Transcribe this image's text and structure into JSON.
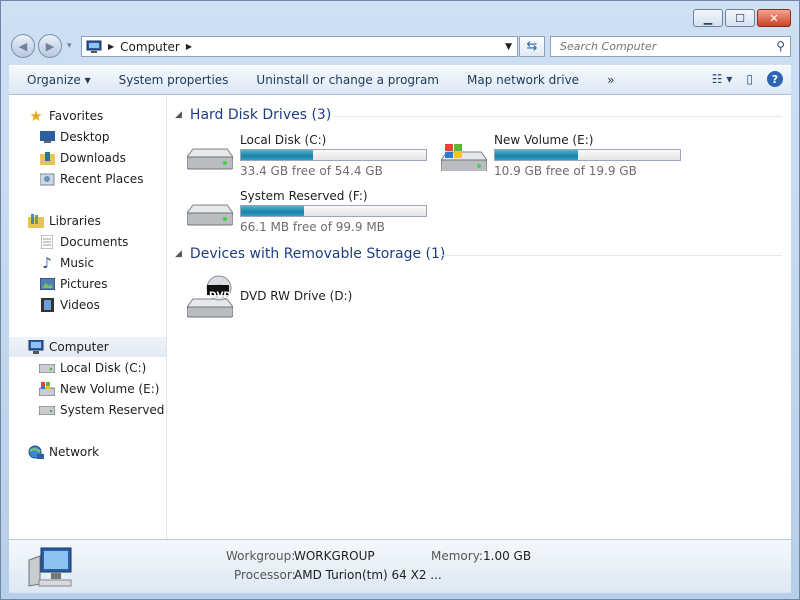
{
  "window": {
    "controls": {
      "minimize": "▁",
      "maximize": "☐",
      "close": "✕"
    }
  },
  "address": {
    "crumb": "Computer"
  },
  "search": {
    "placeholder": "Search Computer"
  },
  "toolbar": {
    "organize": "Organize ▾",
    "system_properties": "System properties",
    "uninstall": "Uninstall or change a program",
    "map_drive": "Map network drive",
    "more": "»"
  },
  "sidebar": {
    "favorites": "Favorites",
    "desktop": "Desktop",
    "downloads": "Downloads",
    "recent_places": "Recent Places",
    "libraries": "Libraries",
    "documents": "Documents",
    "music": "Music",
    "pictures": "Pictures",
    "videos": "Videos",
    "computer": "Computer",
    "local_disk": "Local Disk (C:)",
    "new_volume": "New Volume (E:)",
    "system_reserved": "System Reserved (F:)",
    "network": "Network"
  },
  "groups": {
    "hdd": "Hard Disk Drives (3)",
    "removable": "Devices with Removable Storage (1)"
  },
  "drives": [
    {
      "name": "Local Disk (C:)",
      "free": "33.4 GB free of 54.4 GB",
      "used_fraction": 0.39
    },
    {
      "name": "New Volume (E:)",
      "free": "10.9 GB free of 19.9 GB",
      "used_fraction": 0.45
    },
    {
      "name": "System Reserved (F:)",
      "free": "66.1 MB free of 99.9 MB",
      "used_fraction": 0.34
    }
  ],
  "dvd": {
    "name": "DVD RW Drive (D:)",
    "badge": "DVD"
  },
  "details": {
    "workgroup_label": "Workgroup:",
    "workgroup": "WORKGROUP",
    "memory_label": "Memory:",
    "memory": "1.00 GB",
    "processor_label": "Processor:",
    "processor": "AMD Turion(tm) 64 X2 ..."
  },
  "colors": {
    "accent": "#1e3e83",
    "bar_fill": "#1d7fa6"
  }
}
